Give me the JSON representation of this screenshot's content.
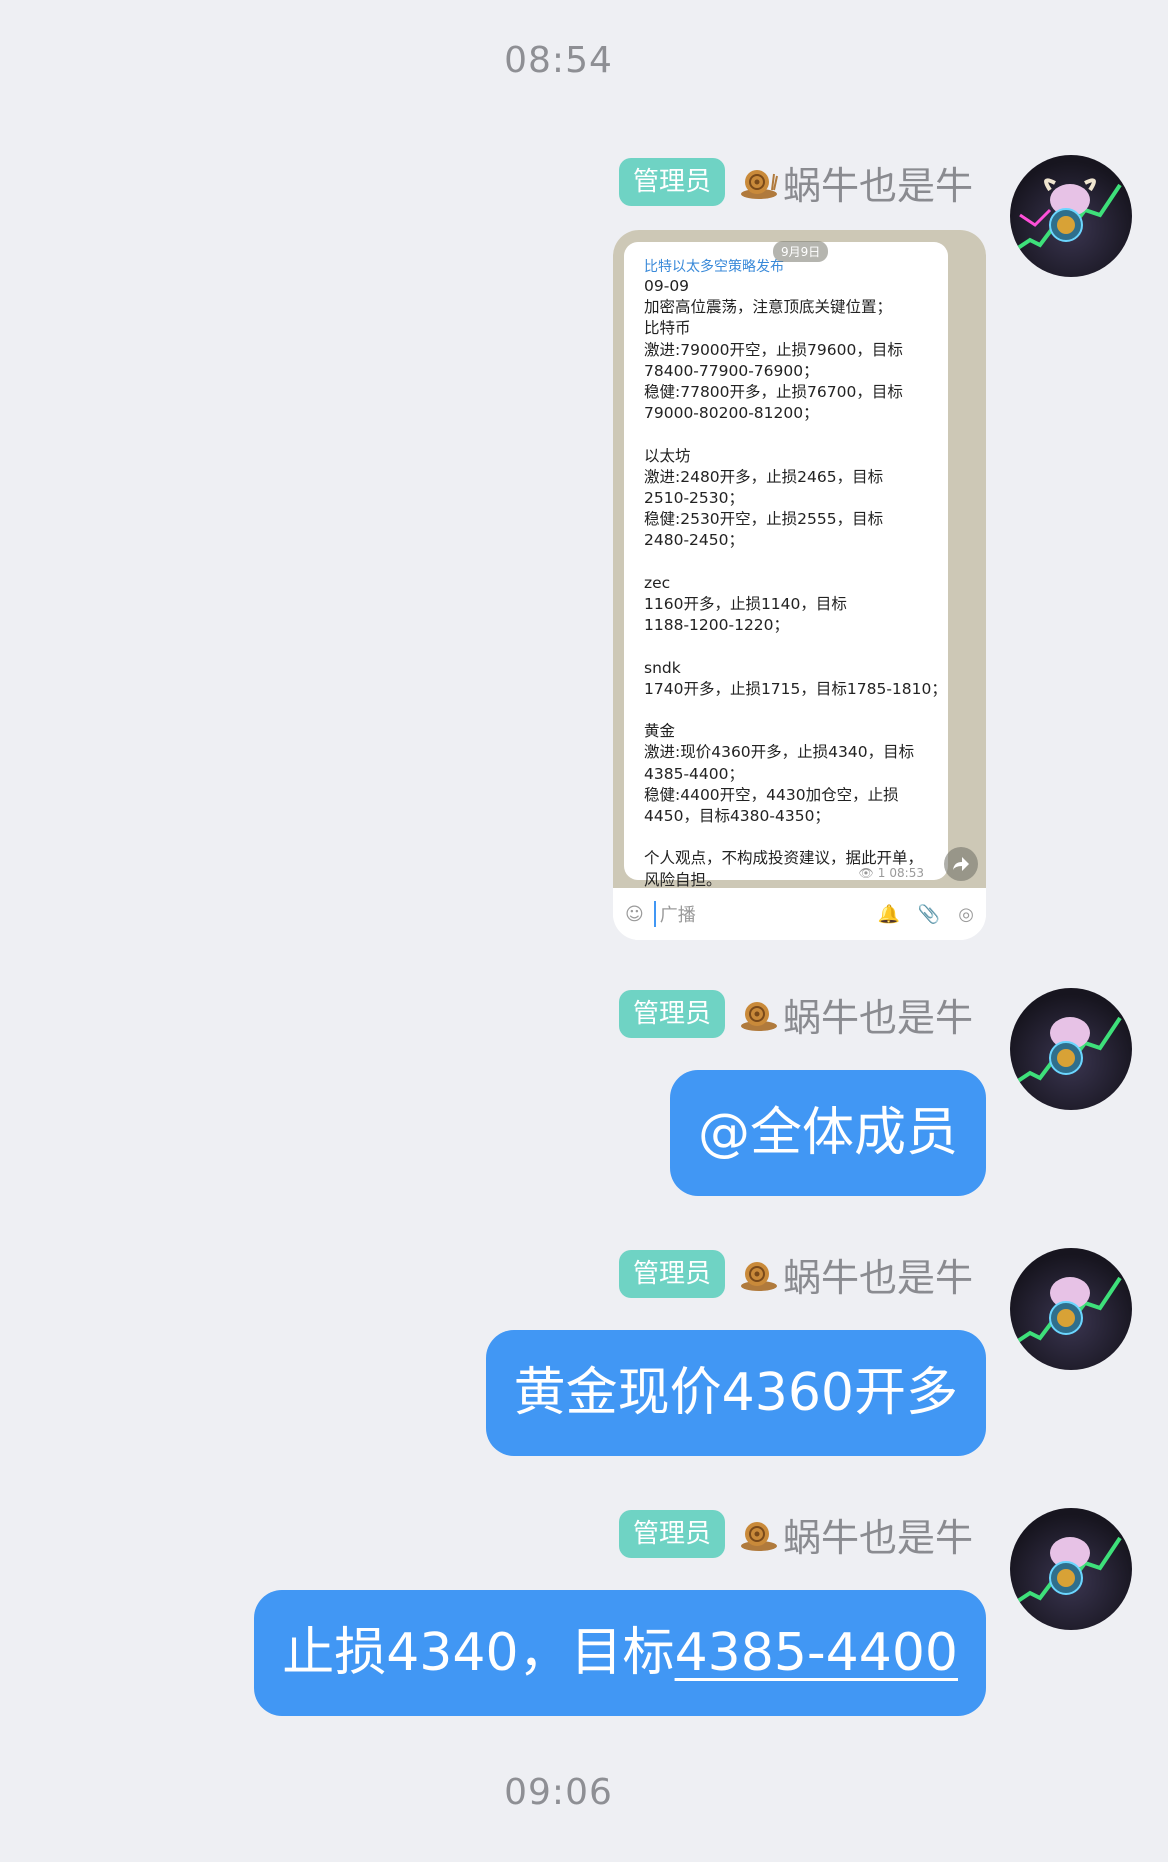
{
  "timestamps": {
    "top": "08:54",
    "bottom": "09:06"
  },
  "role_badge": "管理员",
  "sender_name": "蜗牛也是牛",
  "avatar_icon": "bull-bitcoin-avatar",
  "colors": {
    "bubble": "#4197f4",
    "badge": "#6fd3c4",
    "background": "#eeeff3"
  },
  "screenshot": {
    "channel_title": "比特以太多空策略发布",
    "date_pill": "9月9日",
    "lines": [
      "09-09",
      "加密高位震荡，注意顶底关键位置；",
      "比特币",
      "激进:79000开空，止损79600，目标",
      "78400-77900-76900；",
      "稳健:77800开多，止损76700，目标",
      "79000-80200-81200；",
      "",
      "以太坊",
      "激进:2480开多，止损2465，目标",
      "2510-2530；",
      "稳健:2530开空，止损2555，目标",
      "2480-2450；",
      "",
      "zec",
      "1160开多，止损1140，目标",
      "1188-1200-1220；",
      "",
      "sndk",
      "1740开多，止损1715，目标1785-1810；",
      "",
      "黄金",
      "激进:现价4360开多，止损4340，目标",
      "4385-4400；",
      "稳健:4400开空，4430加仓空，止损",
      "4450，目标4380-4350；",
      "",
      "个人观点，不构成投资建议，据此开单，",
      "风险自担。"
    ],
    "views": "1",
    "time": "08:53",
    "input_placeholder": "广播"
  },
  "messages": {
    "m2": "@全体成员",
    "m3": "黄金现价4360开多",
    "m4_text": "止损4340，目标",
    "m4_link": "4385-4400"
  }
}
